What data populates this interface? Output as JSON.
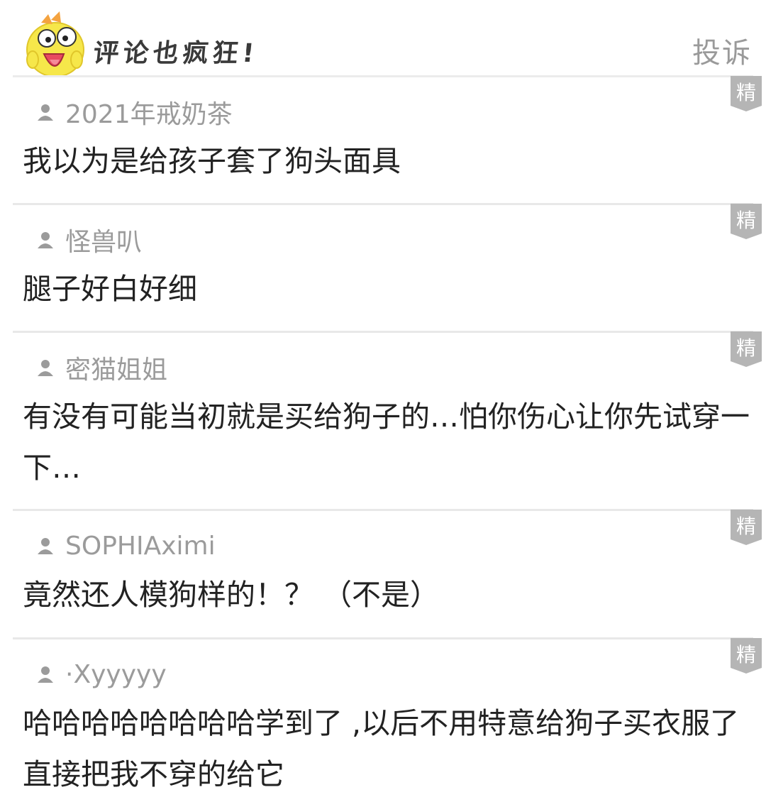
{
  "header": {
    "title": "评论也疯狂!",
    "report_label": "投诉"
  },
  "badge_label": "精",
  "colors": {
    "badge_bg": "#b5b5b5",
    "username": "#9b9b9b",
    "text": "#222222",
    "divider": "#e8e8e8",
    "mascot": "#f6e74a"
  },
  "comments": [
    {
      "user": "2021年戒奶茶",
      "text": "我以为是给孩子套了狗头面具"
    },
    {
      "user": "怪兽叭",
      "text": "腿子好白好细"
    },
    {
      "user": " 密猫姐姐",
      "text": "有没有可能当初就是买给狗子的…怕你伤心让你先试穿一下…"
    },
    {
      "user": "SOPHIAximi",
      "text": "竟然还人模狗样的！？ （不是）"
    },
    {
      "user": "·Xyyyyy",
      "text": "哈哈哈哈哈哈哈哈学到了 ,以后不用特意给狗子买衣服了直接把我不穿的给它"
    }
  ]
}
